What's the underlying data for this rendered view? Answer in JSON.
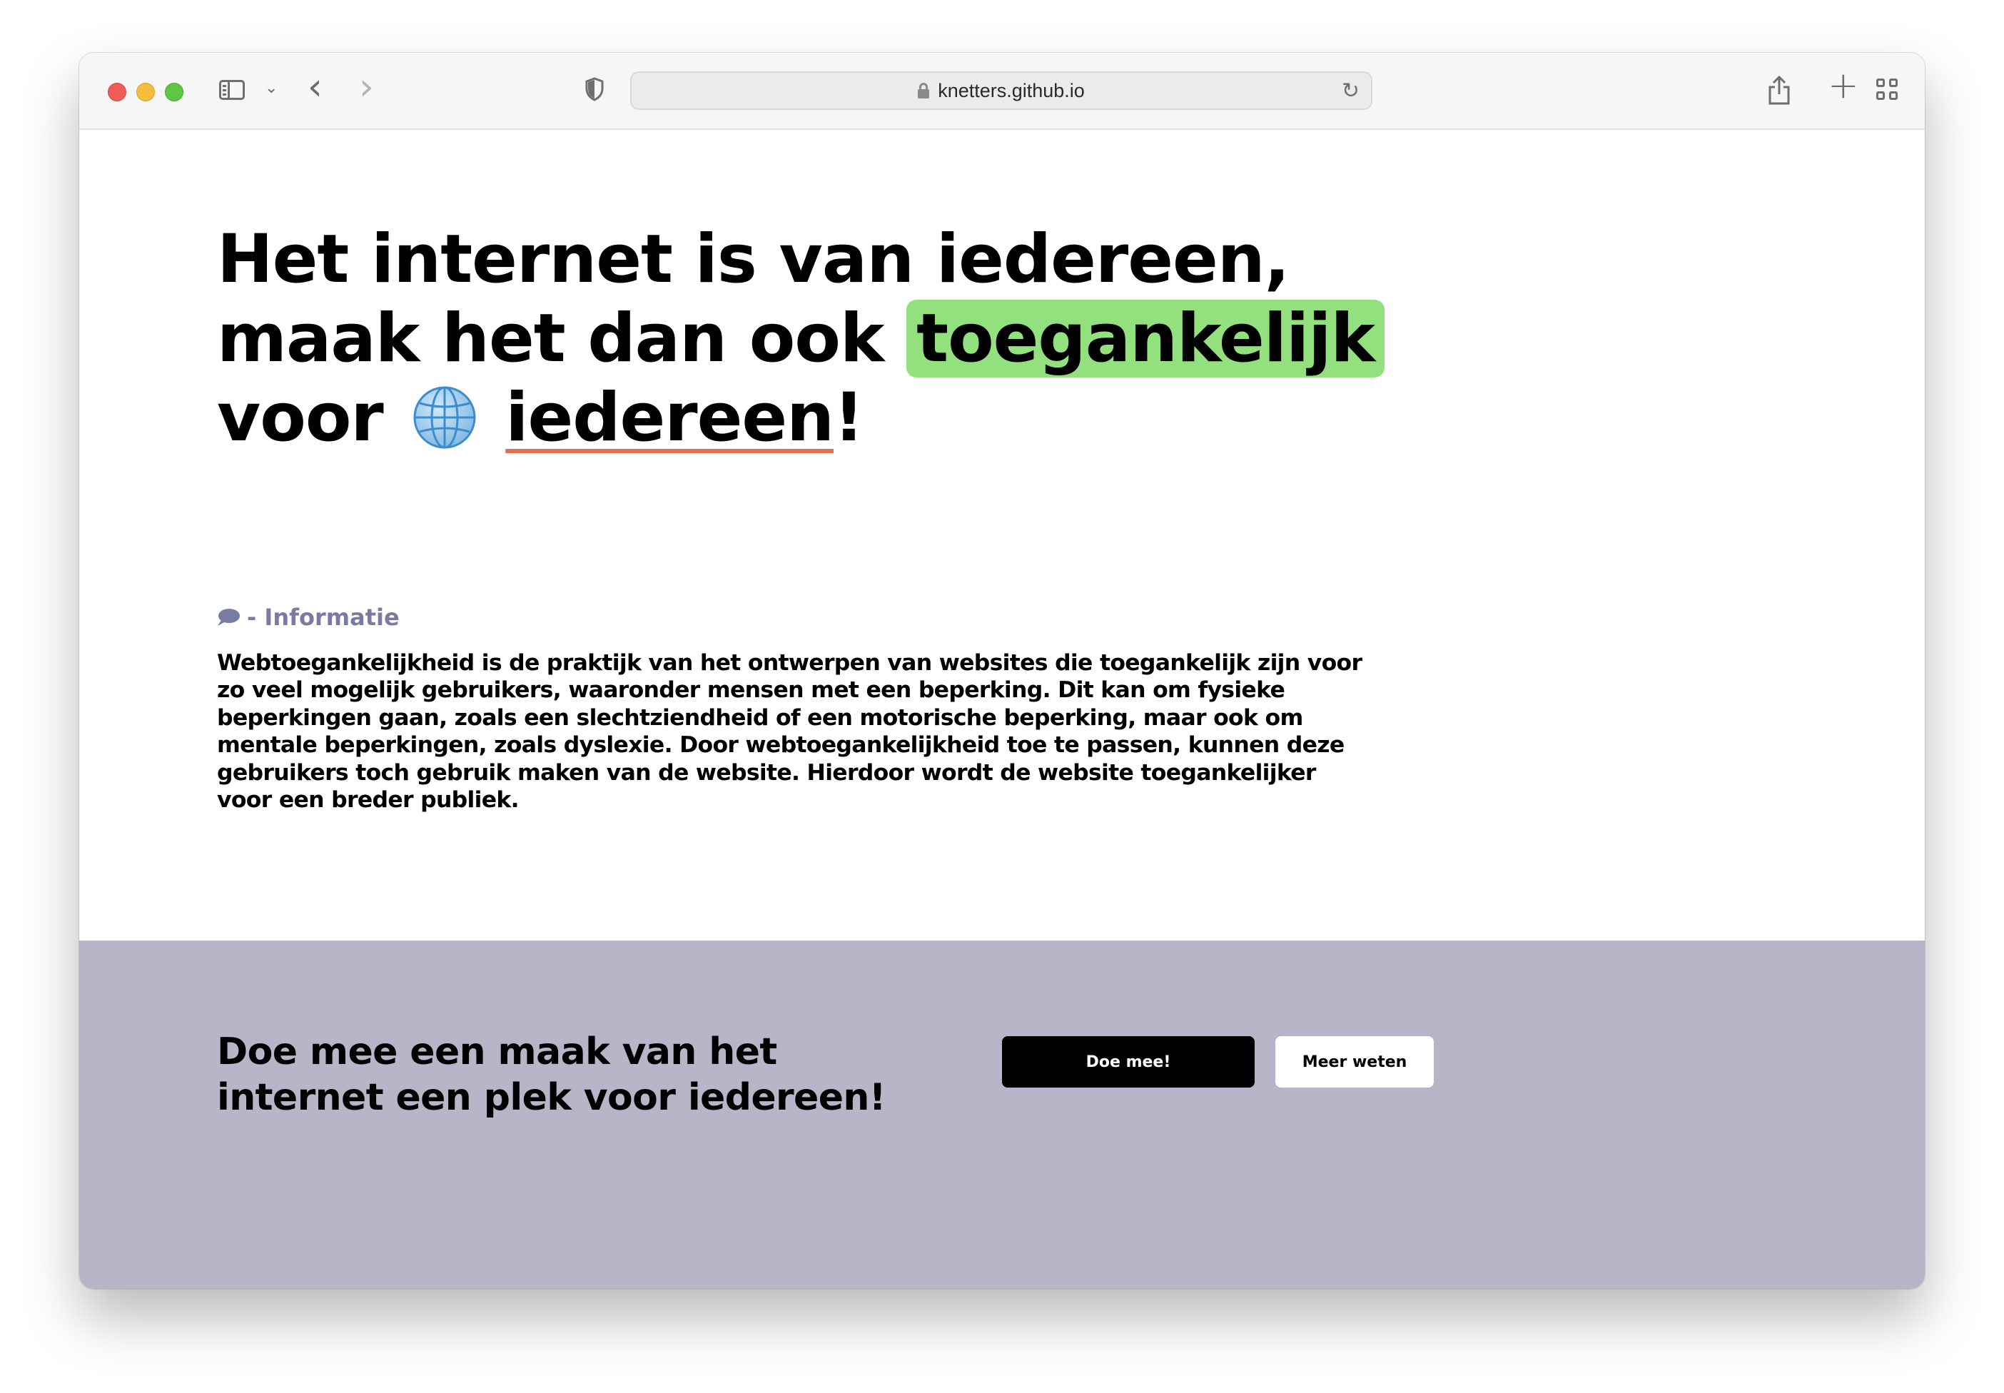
{
  "browser": {
    "url": "knetters.github.io",
    "icons": [
      "sidebar-icon",
      "chevron-down-icon",
      "back-icon",
      "forward-icon",
      "shield-icon",
      "lock-icon",
      "reload-icon",
      "share-icon",
      "new-tab-icon",
      "tab-overview-icon"
    ]
  },
  "hero": {
    "line1": "Het internet is van iedereen,",
    "line2_prefix": "maak het dan ook ",
    "highlight": "toegankelijk",
    "line3_prefix": "voor ",
    "underlined": "iedereen",
    "suffix": "!"
  },
  "info": {
    "label": "- Informatie",
    "text": "Webtoegankelijkheid is de praktijk van het ontwerpen van websites die toegankelijk zijn voor zo veel mogelijk gebruikers, waaronder mensen met een beperking. Dit kan om fysieke beperkingen gaan, zoals een slechtziendheid of een motorische beperking, maar ook om mentale beperkingen, zoals dyslexie. Door webtoegankelijkheid toe te passen, kunnen deze gebruikers toch gebruik maken van de website. Hierdoor wordt de website toegankelijker voor een breder publiek."
  },
  "cta": {
    "title": "Doe mee een maak van het internet een plek voor iedereen!",
    "primary_label": "Doe mee!",
    "secondary_label": "Meer weten"
  },
  "colors": {
    "highlight": "#93e07f",
    "underline": "#e36f50",
    "info_label": "#7b7aa3",
    "cta_background": "#b7b5c8"
  }
}
